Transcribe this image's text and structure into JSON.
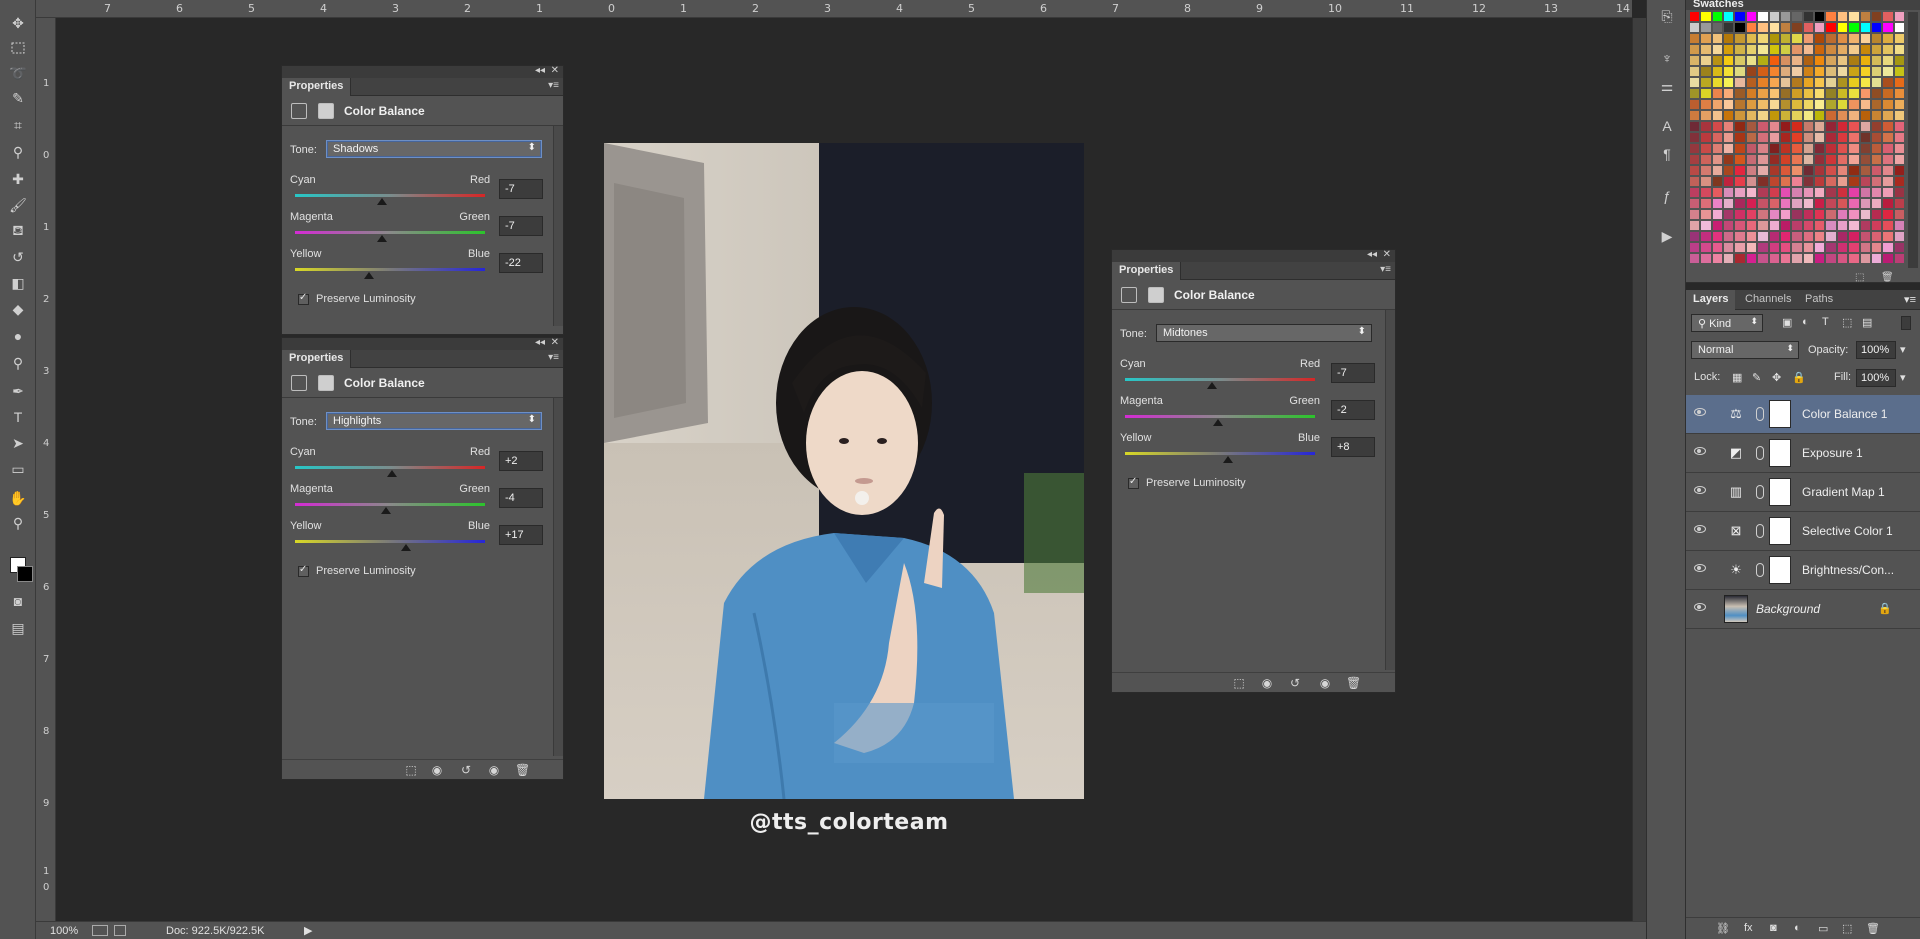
{
  "status": {
    "zoom": "100%",
    "doc": "Doc: 922.5K/922.5K"
  },
  "ruler": {
    "top_marks": [
      "7",
      "6",
      "5",
      "4",
      "3",
      "2",
      "1",
      "0",
      "1",
      "2",
      "3",
      "4",
      "5",
      "6",
      "7",
      "8",
      "9",
      "10",
      "11",
      "12",
      "13",
      "14"
    ],
    "left_marks": [
      "1",
      "0",
      "1",
      "2",
      "3",
      "4",
      "5",
      "6",
      "7",
      "8",
      "9",
      "1",
      "0"
    ]
  },
  "watermark": "@tts_colorteam",
  "panels": [
    {
      "tab": "Properties",
      "title": "Color Balance",
      "tone_label": "Tone:",
      "tone": "Shadows",
      "sliders": [
        {
          "left": "Cyan",
          "right": "Red",
          "value": "-7",
          "fraction": 0.46
        },
        {
          "left": "Magenta",
          "right": "Green",
          "value": "-7",
          "fraction": 0.46
        },
        {
          "left": "Yellow",
          "right": "Blue",
          "value": "-22",
          "fraction": 0.39
        }
      ],
      "preserve": "Preserve Luminosity"
    },
    {
      "tab": "Properties",
      "title": "Color Balance",
      "tone_label": "Tone:",
      "tone": "Highlights",
      "sliders": [
        {
          "left": "Cyan",
          "right": "Red",
          "value": "+2",
          "fraction": 0.51
        },
        {
          "left": "Magenta",
          "right": "Green",
          "value": "-4",
          "fraction": 0.48
        },
        {
          "left": "Yellow",
          "right": "Blue",
          "value": "+17",
          "fraction": 0.585
        }
      ],
      "preserve": "Preserve Luminosity"
    },
    {
      "tab": "Properties",
      "title": "Color Balance",
      "tone_label": "Tone:",
      "tone": "Midtones",
      "sliders": [
        {
          "left": "Cyan",
          "right": "Red",
          "value": "-7",
          "fraction": 0.46
        },
        {
          "left": "Magenta",
          "right": "Green",
          "value": "-2",
          "fraction": 0.49
        },
        {
          "left": "Yellow",
          "right": "Blue",
          "value": "+8",
          "fraction": 0.54
        }
      ],
      "preserve": "Preserve Luminosity"
    }
  ],
  "swatches": {
    "title": "Swatches"
  },
  "layers_panel": {
    "tabs": [
      "Layers",
      "Channels",
      "Paths"
    ],
    "kind": "Kind",
    "blend_mode": "Normal",
    "opacity_label": "Opacity:",
    "opacity": "100%",
    "lock_label": "Lock:",
    "fill_label": "Fill:",
    "fill": "100%",
    "layers": [
      {
        "name": "Color Balance 1",
        "selected": true,
        "icon": "balance-icon"
      },
      {
        "name": "Exposure 1",
        "selected": false,
        "icon": "exposure-icon"
      },
      {
        "name": "Gradient Map 1",
        "selected": false,
        "icon": "gradient-map-icon"
      },
      {
        "name": "Selective Color 1",
        "selected": false,
        "icon": "selective-color-icon"
      },
      {
        "name": "Brightness/Con...",
        "selected": false,
        "icon": "brightness-icon"
      },
      {
        "name": "Background",
        "selected": false,
        "icon": "photo-thumbnail"
      }
    ]
  },
  "colors": {
    "accent": "#5b6e8c",
    "panel": "#535353",
    "workspace": "#282828"
  }
}
